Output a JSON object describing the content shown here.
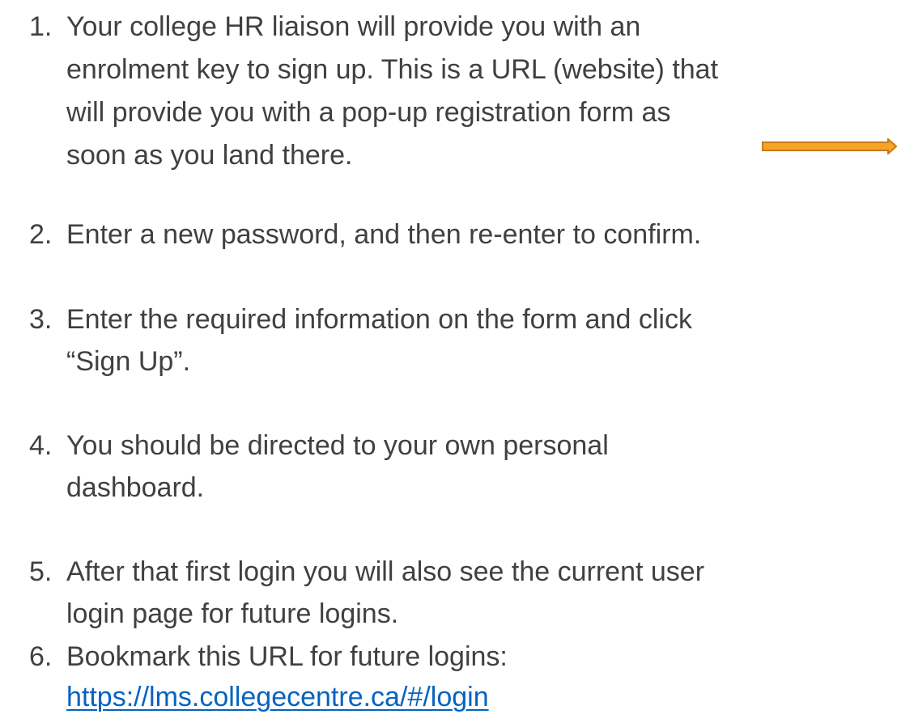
{
  "steps": [
    {
      "number": "1.",
      "lines": [
        "Your college HR liaison will provide you with an",
        "enrolment key to sign up. This is a URL (website) that",
        "will provide you with a pop-up registration form as",
        "soon as you land there."
      ]
    },
    {
      "number": "2.",
      "lines": [
        "Enter a new password, and then re-enter to confirm."
      ]
    },
    {
      "number": "3.",
      "lines": [
        "Enter the required information on the form and click",
        "“Sign Up”."
      ]
    },
    {
      "number": "4.",
      "lines": [
        "You should be directed to your own personal",
        "dashboard."
      ]
    },
    {
      "number": "5.",
      "lines": [
        "After that first login you will also see the current user",
        "login page for future logins."
      ]
    },
    {
      "number": "6.",
      "lines": [
        "Bookmark this URL for future logins:"
      ],
      "link": "https://lms.collegecentre.ca/#/login"
    }
  ],
  "arrow": {
    "icon": "arrow-right-icon",
    "fill": "#f7a427",
    "stroke": "#c47a1a"
  }
}
